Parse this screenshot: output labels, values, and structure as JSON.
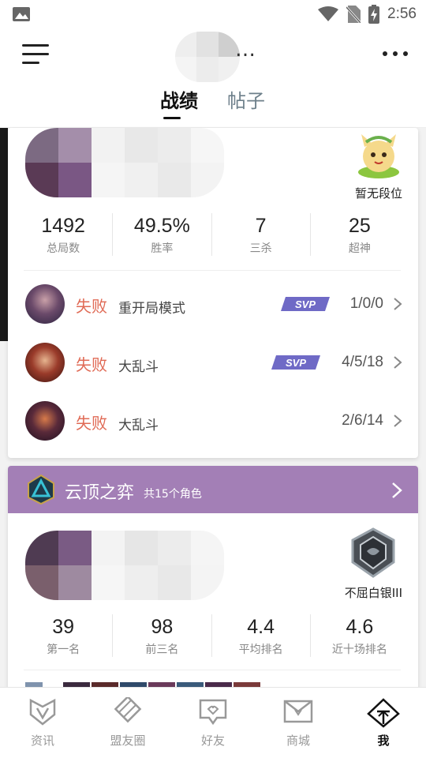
{
  "status_bar": {
    "time": "2:56"
  },
  "header": {
    "name_fragment": "…",
    "tabs": [
      {
        "label": "战绩",
        "active": true
      },
      {
        "label": "帖子",
        "active": false
      }
    ]
  },
  "lol_card": {
    "rank_label": "暂无段位",
    "stats": [
      {
        "value": "1492",
        "label": "总局数"
      },
      {
        "value": "49.5%",
        "label": "胜率"
      },
      {
        "value": "7",
        "label": "三杀"
      },
      {
        "value": "25",
        "label": "超神"
      }
    ],
    "matches": [
      {
        "result": "失败",
        "mode": "重开局模式",
        "svp": true,
        "kda": "1/0/0"
      },
      {
        "result": "失败",
        "mode": "大乱斗",
        "svp": true,
        "kda": "4/5/18"
      },
      {
        "result": "失败",
        "mode": "大乱斗",
        "svp": false,
        "kda": "2/6/14"
      }
    ]
  },
  "tft_card": {
    "title": "云顶之弈",
    "subtitle": "共15个角色",
    "rank_label": "不屈白银III",
    "stats": [
      {
        "value": "39",
        "label": "第一名"
      },
      {
        "value": "98",
        "label": "前三名"
      },
      {
        "value": "4.4",
        "label": "平均排名"
      },
      {
        "value": "4.6",
        "label": "近十场排名"
      }
    ]
  },
  "bottom_nav": [
    {
      "label": "资讯",
      "active": false
    },
    {
      "label": "盟友圈",
      "active": false
    },
    {
      "label": "好友",
      "active": false
    },
    {
      "label": "商城",
      "active": false
    },
    {
      "label": "我",
      "active": true
    }
  ],
  "colors": {
    "loss": "#e06a55",
    "tft_banner": "#a37fb6",
    "accent_text": "#222222"
  }
}
